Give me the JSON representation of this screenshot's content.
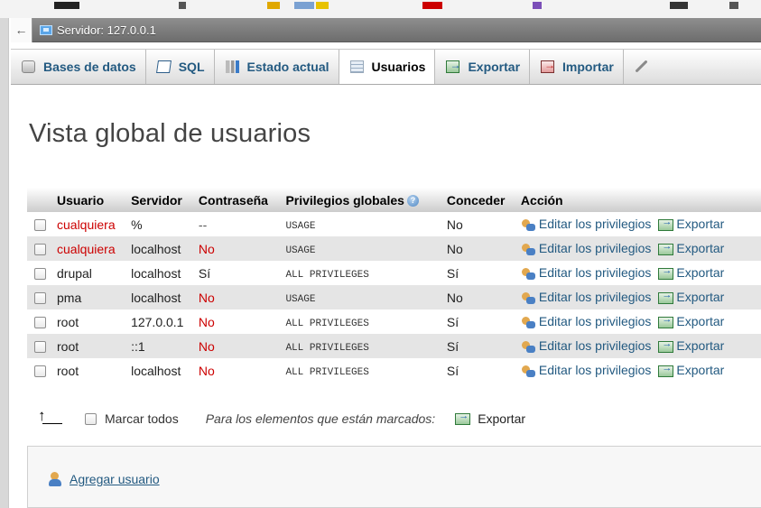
{
  "server_bar": {
    "label": "Servidor: 127.0.0.1",
    "back_symbol": "←"
  },
  "tabs": [
    {
      "label": "Bases de datos",
      "icon": "database-icon",
      "active": false
    },
    {
      "label": "SQL",
      "icon": "sql-icon",
      "active": false
    },
    {
      "label": "Estado actual",
      "icon": "status-chart-icon",
      "active": false
    },
    {
      "label": "Usuarios",
      "icon": "users-icon",
      "active": true
    },
    {
      "label": "Exportar",
      "icon": "export-icon",
      "active": false
    },
    {
      "label": "Importar",
      "icon": "import-icon",
      "active": false
    }
  ],
  "page_title": "Vista global de usuarios",
  "table": {
    "headers": {
      "user": "Usuario",
      "host": "Servidor",
      "password": "Contraseña",
      "global_privs": "Privilegios globales",
      "grant": "Conceder",
      "action": "Acción"
    },
    "rows": [
      {
        "user": "cualquiera",
        "user_color": "#cc0000",
        "host": "%",
        "password": "--",
        "password_color": "#555555",
        "privileges": "USAGE",
        "grant": "No"
      },
      {
        "user": "cualquiera",
        "user_color": "#cc0000",
        "host": "localhost",
        "password": "No",
        "password_color": "#cc0000",
        "privileges": "USAGE",
        "grant": "No"
      },
      {
        "user": "drupal",
        "user_color": "#222222",
        "host": "localhost",
        "password": "Sí",
        "password_color": "#222222",
        "privileges": "ALL PRIVILEGES",
        "grant": "Sí"
      },
      {
        "user": "pma",
        "user_color": "#222222",
        "host": "localhost",
        "password": "No",
        "password_color": "#cc0000",
        "privileges": "USAGE",
        "grant": "No"
      },
      {
        "user": "root",
        "user_color": "#222222",
        "host": "127.0.0.1",
        "password": "No",
        "password_color": "#cc0000",
        "privileges": "ALL PRIVILEGES",
        "grant": "Sí"
      },
      {
        "user": "root",
        "user_color": "#222222",
        "host": "::1",
        "password": "No",
        "password_color": "#cc0000",
        "privileges": "ALL PRIVILEGES",
        "grant": "Sí"
      },
      {
        "user": "root",
        "user_color": "#222222",
        "host": "localhost",
        "password": "No",
        "password_color": "#cc0000",
        "privileges": "ALL PRIVILEGES",
        "grant": "Sí"
      }
    ],
    "edit_label": "Editar los privilegios",
    "export_label": "Exportar"
  },
  "footer": {
    "check_all": "Marcar todos",
    "with_selected": "Para los elementos que están marcados:",
    "export": "Exportar"
  },
  "add_user": {
    "label": "Agregar usuario"
  },
  "colors": {
    "link": "#235a81",
    "alert": "#cc0000",
    "row_alt": "#e5e5e5"
  }
}
